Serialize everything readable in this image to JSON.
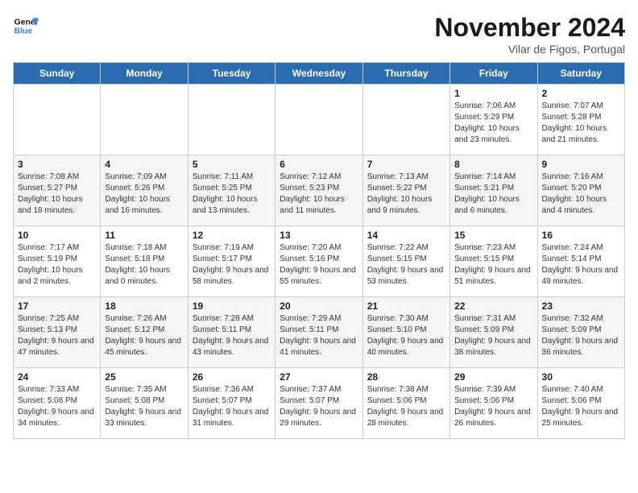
{
  "logo": {
    "line1": "General",
    "line2": "Blue"
  },
  "title": "November 2024",
  "location": "Vilar de Figos, Portugal",
  "days_of_week": [
    "Sunday",
    "Monday",
    "Tuesday",
    "Wednesday",
    "Thursday",
    "Friday",
    "Saturday"
  ],
  "weeks": [
    [
      {
        "day": "",
        "info": ""
      },
      {
        "day": "",
        "info": ""
      },
      {
        "day": "",
        "info": ""
      },
      {
        "day": "",
        "info": ""
      },
      {
        "day": "",
        "info": ""
      },
      {
        "day": "1",
        "info": "Sunrise: 7:06 AM\nSunset: 5:29 PM\nDaylight: 10 hours and 23 minutes."
      },
      {
        "day": "2",
        "info": "Sunrise: 7:07 AM\nSunset: 5:28 PM\nDaylight: 10 hours and 21 minutes."
      }
    ],
    [
      {
        "day": "3",
        "info": "Sunrise: 7:08 AM\nSunset: 5:27 PM\nDaylight: 10 hours and 18 minutes."
      },
      {
        "day": "4",
        "info": "Sunrise: 7:09 AM\nSunset: 5:26 PM\nDaylight: 10 hours and 16 minutes."
      },
      {
        "day": "5",
        "info": "Sunrise: 7:11 AM\nSunset: 5:25 PM\nDaylight: 10 hours and 13 minutes."
      },
      {
        "day": "6",
        "info": "Sunrise: 7:12 AM\nSunset: 5:23 PM\nDaylight: 10 hours and 11 minutes."
      },
      {
        "day": "7",
        "info": "Sunrise: 7:13 AM\nSunset: 5:22 PM\nDaylight: 10 hours and 9 minutes."
      },
      {
        "day": "8",
        "info": "Sunrise: 7:14 AM\nSunset: 5:21 PM\nDaylight: 10 hours and 6 minutes."
      },
      {
        "day": "9",
        "info": "Sunrise: 7:16 AM\nSunset: 5:20 PM\nDaylight: 10 hours and 4 minutes."
      }
    ],
    [
      {
        "day": "10",
        "info": "Sunrise: 7:17 AM\nSunset: 5:19 PM\nDaylight: 10 hours and 2 minutes."
      },
      {
        "day": "11",
        "info": "Sunrise: 7:18 AM\nSunset: 5:18 PM\nDaylight: 10 hours and 0 minutes."
      },
      {
        "day": "12",
        "info": "Sunrise: 7:19 AM\nSunset: 5:17 PM\nDaylight: 9 hours and 58 minutes."
      },
      {
        "day": "13",
        "info": "Sunrise: 7:20 AM\nSunset: 5:16 PM\nDaylight: 9 hours and 55 minutes."
      },
      {
        "day": "14",
        "info": "Sunrise: 7:22 AM\nSunset: 5:15 PM\nDaylight: 9 hours and 53 minutes."
      },
      {
        "day": "15",
        "info": "Sunrise: 7:23 AM\nSunset: 5:15 PM\nDaylight: 9 hours and 51 minutes."
      },
      {
        "day": "16",
        "info": "Sunrise: 7:24 AM\nSunset: 5:14 PM\nDaylight: 9 hours and 49 minutes."
      }
    ],
    [
      {
        "day": "17",
        "info": "Sunrise: 7:25 AM\nSunset: 5:13 PM\nDaylight: 9 hours and 47 minutes."
      },
      {
        "day": "18",
        "info": "Sunrise: 7:26 AM\nSunset: 5:12 PM\nDaylight: 9 hours and 45 minutes."
      },
      {
        "day": "19",
        "info": "Sunrise: 7:28 AM\nSunset: 5:11 PM\nDaylight: 9 hours and 43 minutes."
      },
      {
        "day": "20",
        "info": "Sunrise: 7:29 AM\nSunset: 5:11 PM\nDaylight: 9 hours and 41 minutes."
      },
      {
        "day": "21",
        "info": "Sunrise: 7:30 AM\nSunset: 5:10 PM\nDaylight: 9 hours and 40 minutes."
      },
      {
        "day": "22",
        "info": "Sunrise: 7:31 AM\nSunset: 5:09 PM\nDaylight: 9 hours and 38 minutes."
      },
      {
        "day": "23",
        "info": "Sunrise: 7:32 AM\nSunset: 5:09 PM\nDaylight: 9 hours and 36 minutes."
      }
    ],
    [
      {
        "day": "24",
        "info": "Sunrise: 7:33 AM\nSunset: 5:08 PM\nDaylight: 9 hours and 34 minutes."
      },
      {
        "day": "25",
        "info": "Sunrise: 7:35 AM\nSunset: 5:08 PM\nDaylight: 9 hours and 33 minutes."
      },
      {
        "day": "26",
        "info": "Sunrise: 7:36 AM\nSunset: 5:07 PM\nDaylight: 9 hours and 31 minutes."
      },
      {
        "day": "27",
        "info": "Sunrise: 7:37 AM\nSunset: 5:07 PM\nDaylight: 9 hours and 29 minutes."
      },
      {
        "day": "28",
        "info": "Sunrise: 7:38 AM\nSunset: 5:06 PM\nDaylight: 9 hours and 28 minutes."
      },
      {
        "day": "29",
        "info": "Sunrise: 7:39 AM\nSunset: 5:06 PM\nDaylight: 9 hours and 26 minutes."
      },
      {
        "day": "30",
        "info": "Sunrise: 7:40 AM\nSunset: 5:06 PM\nDaylight: 9 hours and 25 minutes."
      }
    ]
  ]
}
